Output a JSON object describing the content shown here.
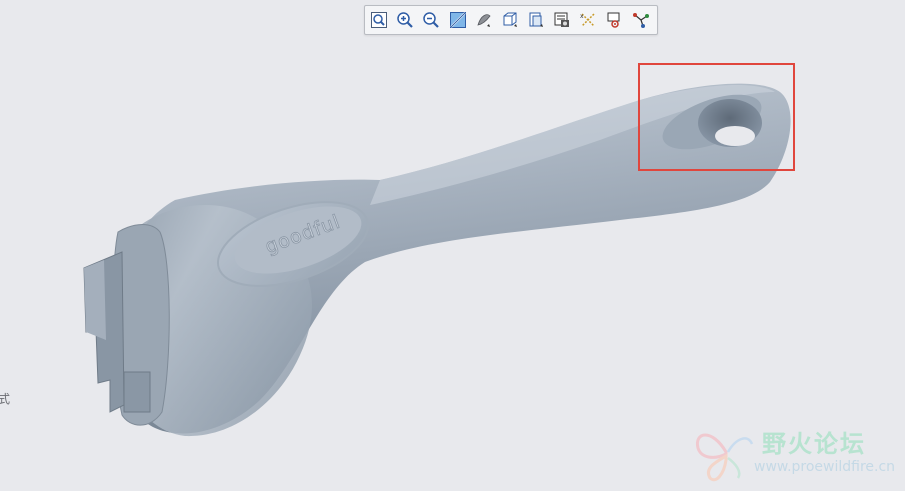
{
  "toolbar": {
    "buttons": [
      {
        "name": "refit-icon"
      },
      {
        "name": "zoom-in-icon"
      },
      {
        "name": "zoom-out-icon"
      },
      {
        "name": "repaint-icon"
      },
      {
        "name": "display-style-icon"
      },
      {
        "name": "saved-orientations-icon"
      },
      {
        "name": "view-manager-icon"
      },
      {
        "name": "section-view-icon"
      },
      {
        "name": "datum-display-icon"
      },
      {
        "name": "annotation-display-icon"
      },
      {
        "name": "spin-center-icon"
      }
    ]
  },
  "model": {
    "logo_text": "goodful",
    "highlight_color": "#e0463d"
  },
  "left_label": "式",
  "watermark": {
    "title": "野火论坛",
    "url": "www.proewildfire.cn"
  }
}
